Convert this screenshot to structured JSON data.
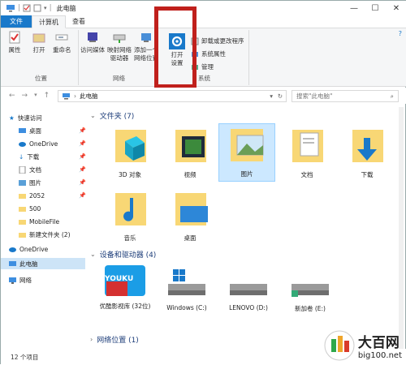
{
  "titlebar": {
    "title": "此电脑",
    "min": "—",
    "max": "☐",
    "close": "✕"
  },
  "tabs": [
    {
      "label": "文件"
    },
    {
      "label": "计算机"
    },
    {
      "label": "查看"
    }
  ],
  "ribbon": {
    "location": {
      "label": "位置",
      "buttons": [
        "属性",
        "打开",
        "重命名"
      ]
    },
    "network": {
      "label": "网络",
      "buttons": [
        "访问媒体",
        "映射网络驱动器",
        "添加一个网络位置"
      ]
    },
    "system": {
      "label": "系统",
      "open_settings": "打开设置",
      "uninstall": "卸载或更改程序",
      "sys_props": "系统属性",
      "manage": "管理"
    }
  },
  "address": {
    "path": "此电脑",
    "search_placeholder": "搜索\"此电脑\""
  },
  "sidebar": {
    "items": [
      {
        "label": "快速访问"
      },
      {
        "label": "桌面"
      },
      {
        "label": "OneDrive"
      },
      {
        "label": "下载"
      },
      {
        "label": "文档"
      },
      {
        "label": "图片"
      },
      {
        "label": "2052"
      },
      {
        "label": "500"
      },
      {
        "label": "MobileFile"
      },
      {
        "label": "新建文件夹 (2)"
      },
      {
        "label": "OneDrive"
      },
      {
        "label": "此电脑"
      },
      {
        "label": "网络"
      }
    ]
  },
  "main": {
    "folders_header": "文件夹 (7)",
    "folders": [
      {
        "label": "3D 对象"
      },
      {
        "label": "视频"
      },
      {
        "label": "图片"
      },
      {
        "label": "文档"
      },
      {
        "label": "下载"
      },
      {
        "label": "音乐"
      },
      {
        "label": "桌面"
      }
    ],
    "devices_header": "设备和驱动器 (4)",
    "drives": [
      {
        "label": "优酷影视库 (32位)",
        "logo": "YOUKU"
      },
      {
        "label": "Windows (C:)"
      },
      {
        "label": "LENOVO (D:)"
      },
      {
        "label": "新加卷 (E:)"
      }
    ],
    "network_header": "网络位置 (1)"
  },
  "status": {
    "count": "12 个项目"
  },
  "watermark": {
    "big": "大百网",
    "small": "big100.net"
  },
  "colors": {
    "accent": "#1979ca",
    "highlight": "#c0201c",
    "folder": "#f8d775"
  }
}
